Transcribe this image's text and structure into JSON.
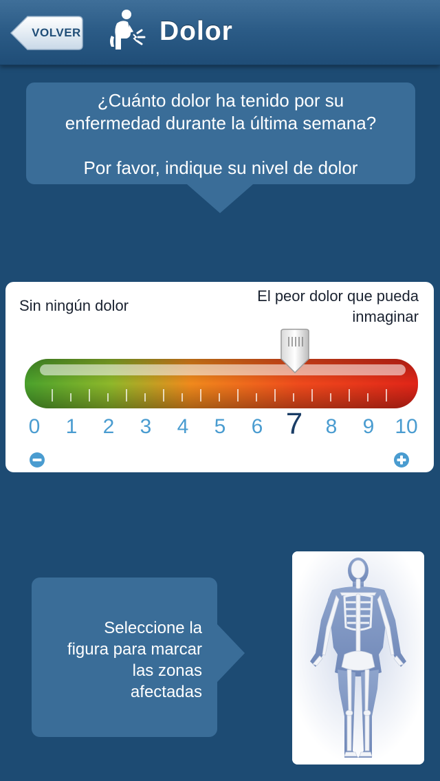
{
  "header": {
    "back_label": "VOLVER",
    "title": "Dolor"
  },
  "question": {
    "line1": "¿Cuánto dolor ha tenido por su",
    "line2": "enfermedad durante la última semana?",
    "line3": "Por favor, indique su nivel de dolor"
  },
  "scale": {
    "min_label": "Sin ningún dolor",
    "max_label": "El peor dolor que pueda inmaginar",
    "numbers": [
      "0",
      "1",
      "2",
      "3",
      "4",
      "5",
      "6",
      "7",
      "8",
      "9",
      "10"
    ],
    "selected_value": 7,
    "icons": [
      "minus-icon",
      "plus-icon"
    ]
  },
  "hint": {
    "line1": "Seleccione la",
    "line2": "figura para marcar",
    "line3": "las zonas",
    "line4": "afectadas"
  },
  "colors": {
    "background": "#1d4b73",
    "bubble": "#3a6d98",
    "number": "#4a9cd0",
    "number_selected": "#1a3d66",
    "bar_low": "#56a82d",
    "bar_mid": "#f27a1a",
    "bar_high": "#e2261a"
  },
  "figure": {
    "icon": "skeleton-icon"
  }
}
